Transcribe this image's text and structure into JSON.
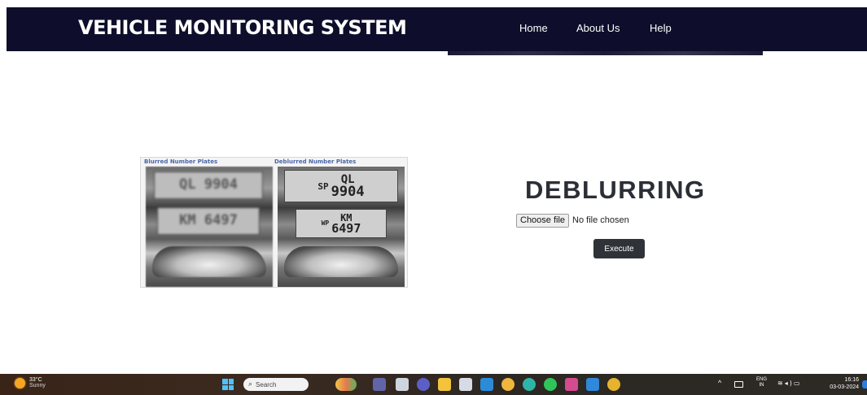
{
  "header": {
    "brand": "VEHICLE MONITORING SYSTEM",
    "nav": [
      {
        "label": "Home"
      },
      {
        "label": "About Us"
      },
      {
        "label": "Help"
      }
    ],
    "background_color": "#0e0e2c"
  },
  "comparison": {
    "left_caption": "Blurred Number Plates",
    "right_caption": "Deblurred Number Plates",
    "left_plate_top": "QL 9904",
    "left_plate_bottom": "KM 6497",
    "right_plate_top_prefix": "SP",
    "right_plate_top": "QL",
    "right_plate_top_number": "9904",
    "right_plate_bottom_prefix": "WP",
    "right_plate_bottom": "KM",
    "right_plate_bottom_number": "6497"
  },
  "deblur": {
    "title": "DEBLURRING",
    "choose_file_label": "Choose file",
    "file_status": "No file chosen",
    "execute_label": "Execute",
    "button_color": "#2f3338"
  },
  "taskbar": {
    "weather_temp": "33°C",
    "weather_condition": "Sunny",
    "search_placeholder": "Search",
    "lang_line1": "ENG",
    "lang_line2": "IN",
    "time": "16:16",
    "date": "03-03-2024",
    "apps": [
      {
        "icon": "widgets-icon",
        "color": "#e9a23b"
      },
      {
        "icon": "teams-icon",
        "color": "#6264a7"
      },
      {
        "icon": "task-view-icon",
        "color": "#d0d0d0"
      },
      {
        "icon": "meet-icon",
        "color": "#5b5fc7"
      },
      {
        "icon": "file-explorer-icon",
        "color": "#f3c33b"
      },
      {
        "icon": "store-icon",
        "color": "#d6dbe6"
      },
      {
        "icon": "mail-icon",
        "color": "#2a8cd8"
      },
      {
        "icon": "chrome-canary-icon",
        "color": "#f0b73c"
      },
      {
        "icon": "edge-icon",
        "color": "#2fb4a8"
      },
      {
        "icon": "whatsapp-icon",
        "color": "#2fc55a"
      },
      {
        "icon": "app-icon",
        "color": "#d54b8f"
      },
      {
        "icon": "vscode-icon",
        "color": "#2f88d9"
      },
      {
        "icon": "chrome-icon",
        "color": "#e5b32e"
      }
    ]
  }
}
